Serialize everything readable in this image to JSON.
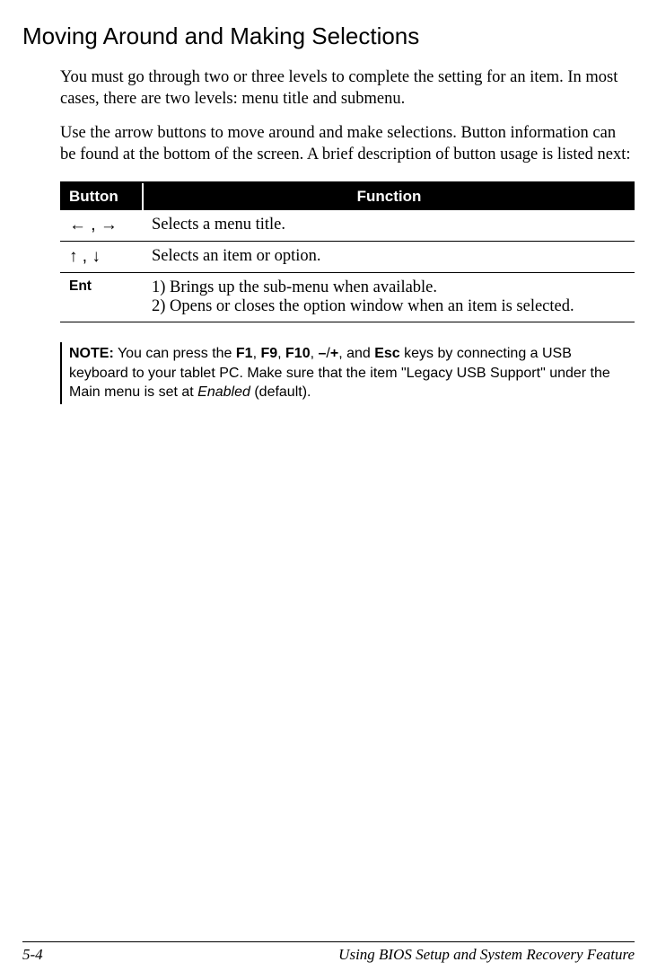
{
  "heading": "Moving Around and Making Selections",
  "para1": "You must go through two or three levels to complete the setting for an item. In most cases, there are two levels: menu title and submenu.",
  "para2": "Use the arrow buttons to move around and make selections. Button information can be found at the bottom of the screen. A brief description of button usage is listed next:",
  "table": {
    "header": {
      "button": "Button",
      "function": "Function"
    },
    "rows": {
      "r1": {
        "button": "← , →",
        "function": "Selects a menu title."
      },
      "r2": {
        "button": "↑ , ↓",
        "function": "Selects an item or option."
      },
      "r3": {
        "button": "Ent",
        "line1": "1) Brings up the sub-menu when available.",
        "line2": "2) Opens or closes the option window when an item is selected."
      }
    }
  },
  "note": {
    "label": "NOTE:",
    "pre": " You can press the ",
    "k1": "F1",
    "sep1": ", ",
    "k2": "F9",
    "sep2": ", ",
    "k3": "F10",
    "sep3": ", ",
    "k4": "–",
    "slash": "/",
    "k5": "+",
    "sep4": ", and ",
    "k6": "Esc",
    "mid": " keys by connecting a USB keyboard to your tablet PC. Make sure that the item \"Legacy USB Support\" under the Main menu is set at ",
    "enabled": "Enabled",
    "post": " (default)."
  },
  "footer": {
    "page": "5-4",
    "chapter": "Using BIOS Setup and System Recovery Feature"
  }
}
